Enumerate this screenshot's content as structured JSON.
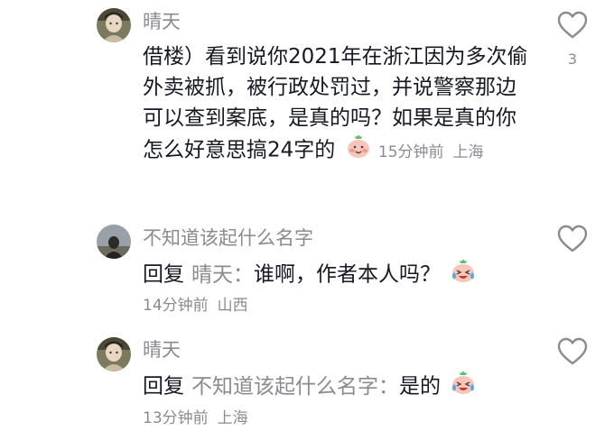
{
  "comments": [
    {
      "username": "晴天",
      "text": "借楼）看到说你2021年在浙江因为多次偷外卖被抓，被行政处罚过，并说警察那边可以查到案底，是真的吗？如果是真的你怎么好意思搞24字的",
      "time": "15分钟前",
      "location": "上海",
      "likes": "3",
      "avatar_icon": "portrait-avatar-icon"
    },
    {
      "username": "不知道该起什么名字",
      "reply_prefix": "回复",
      "reply_to": "晴天：",
      "text": "谁啊，作者本人吗？",
      "time": "14分钟前",
      "location": "山西",
      "avatar_icon": "silhouette-avatar-icon"
    },
    {
      "username": "晴天",
      "reply_prefix": "回复",
      "reply_to": "不知道该起什么名字：",
      "text": "是的",
      "time": "13分钟前",
      "location": "上海",
      "avatar_icon": "portrait-avatar-icon"
    }
  ],
  "colors": {
    "text": "#161823",
    "secondary": "#8a8b91",
    "background": "#ffffff"
  }
}
